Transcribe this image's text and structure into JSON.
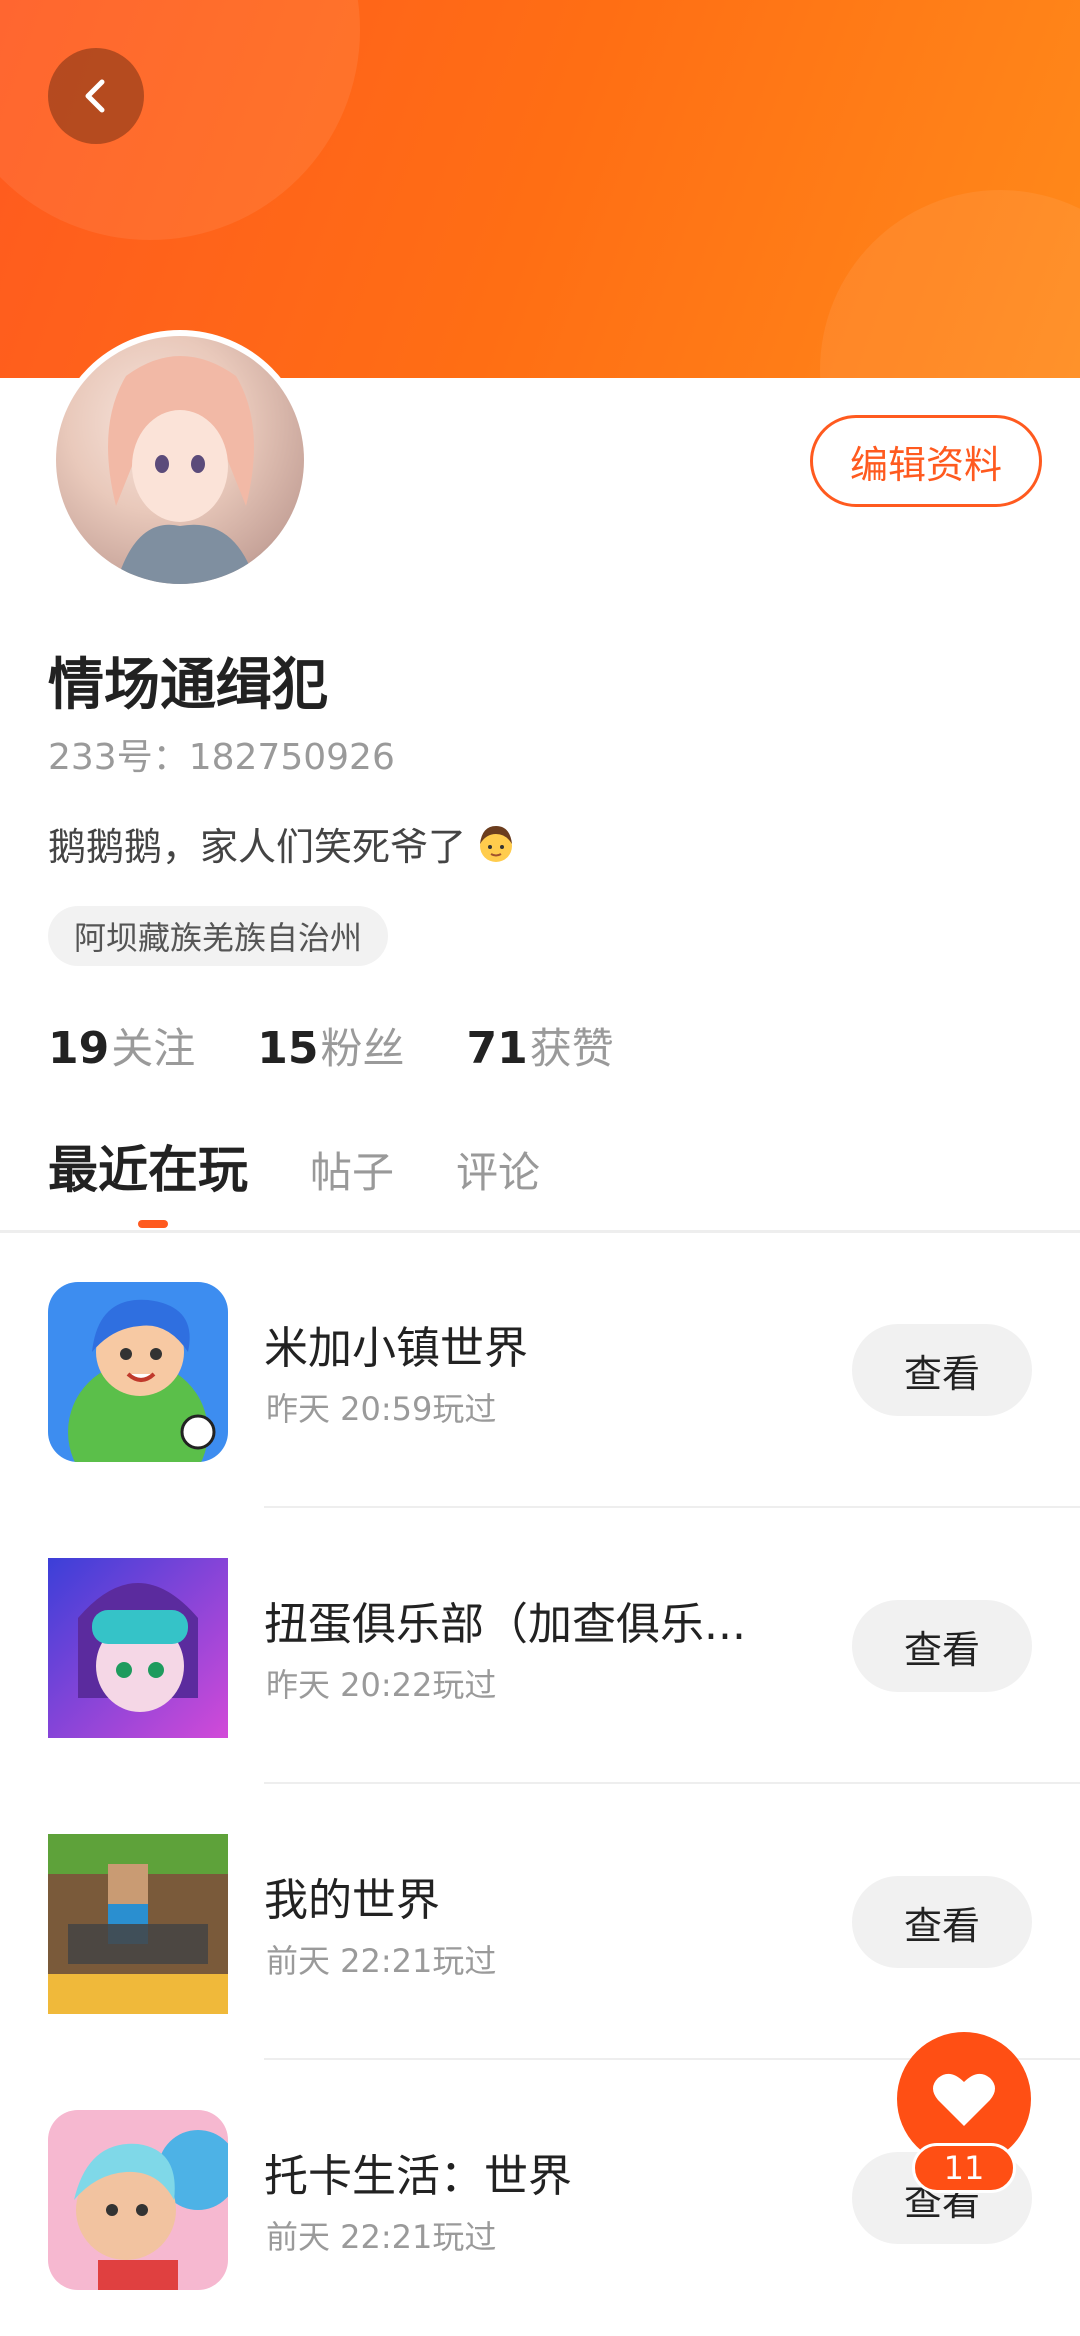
{
  "header": {
    "back_icon": "chevron-left-icon"
  },
  "profile": {
    "name": "情场通缉犯",
    "uid": "233号：182750926",
    "bio": "鹅鹅鹅，家人们笑死爷了",
    "location": "阿坝藏族羌族自治州",
    "edit_label": "编辑资料"
  },
  "stats": [
    {
      "num": "19",
      "label": "关注"
    },
    {
      "num": "15",
      "label": "粉丝"
    },
    {
      "num": "71",
      "label": "获赞"
    }
  ],
  "tabs": [
    {
      "label": "最近在玩",
      "active": true
    },
    {
      "label": "帖子",
      "active": false
    },
    {
      "label": "评论",
      "active": false
    }
  ],
  "games": [
    {
      "title": "米加小镇世界",
      "time": "昨天 20:59玩过",
      "button": "查看"
    },
    {
      "title": "扭蛋俱乐部（加查俱乐...",
      "time": "昨天 20:22玩过",
      "button": "查看"
    },
    {
      "title": "我的世界",
      "time": "前天 22:21玩过",
      "button": "查看"
    },
    {
      "title": "托卡生活：世界",
      "time": "前天 22:21玩过",
      "button": "查看"
    }
  ],
  "fab": {
    "icon": "heart-icon",
    "count": "11"
  },
  "colors": {
    "accent": "#ff5a1f"
  }
}
